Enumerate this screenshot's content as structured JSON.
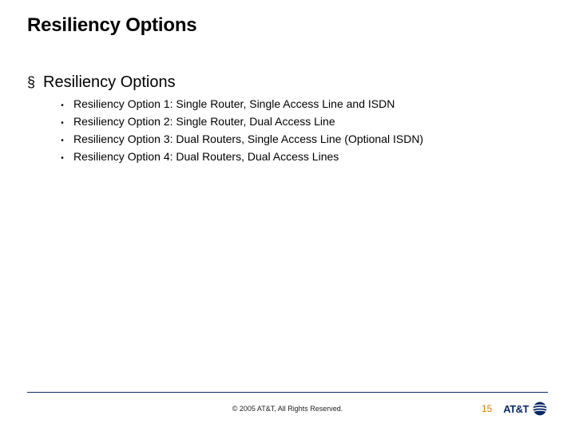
{
  "title": "Resiliency Options",
  "section": {
    "bullet_glyph": "§",
    "heading": "Resiliency Options",
    "items": [
      "Resiliency Option 1: Single Router, Single Access Line and ISDN",
      "Resiliency Option 2: Single Router, Dual Access Line",
      "Resiliency Option 3: Dual Routers, Single Access Line (Optional ISDN)",
      "Resiliency Option 4: Dual Routers, Dual Access Lines"
    ],
    "item_bullet_glyph": "•"
  },
  "footer": {
    "copyright": "© 2005 AT&T, All Rights Reserved.",
    "page_number": "15",
    "logo_text": "AT&T"
  },
  "colors": {
    "accent_orange": "#e07a00",
    "brand_blue": "#0a2a66"
  }
}
